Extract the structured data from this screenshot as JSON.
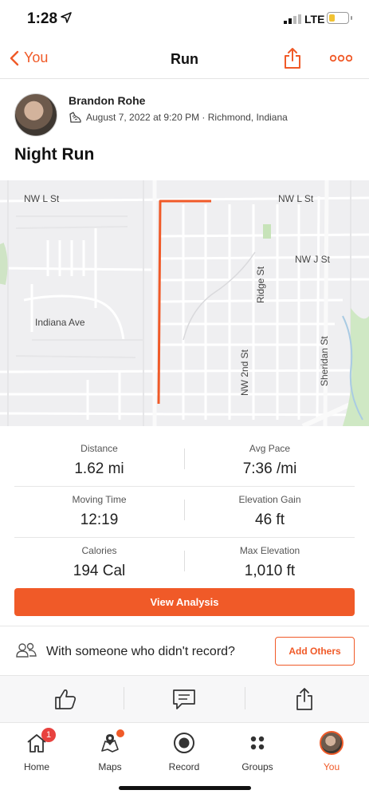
{
  "status_bar": {
    "time": "1:28",
    "network": "LTE"
  },
  "nav": {
    "back_label": "You",
    "title": "Run",
    "share_icon": "share-icon",
    "more_icon": "more-icon"
  },
  "activity": {
    "athlete_name": "Brandon Rohe",
    "date_location": "August 7, 2022 at 9:20 PM · Richmond, Indiana",
    "title": "Night Run"
  },
  "map": {
    "labels": {
      "nw_l_st_left": "NW L St",
      "nw_l_st_right": "NW L St",
      "nw_j_st": "NW J St",
      "indiana_ave": "Indiana Ave",
      "ridge_st": "Ridge St",
      "nw_2nd_st": "NW 2nd St",
      "sheridan_st": "Sheridan St"
    },
    "route_color": "#f05a28"
  },
  "stats": [
    {
      "left": {
        "label": "Distance",
        "value": "1.62 mi"
      },
      "right": {
        "label": "Avg Pace",
        "value": "7:36 /mi"
      }
    },
    {
      "left": {
        "label": "Moving Time",
        "value": "12:19"
      },
      "right": {
        "label": "Elevation Gain",
        "value": "46 ft"
      }
    },
    {
      "left": {
        "label": "Calories",
        "value": "194 Cal"
      },
      "right": {
        "label": "Max Elevation",
        "value": "1,010 ft"
      }
    }
  ],
  "view_analysis_label": "View Analysis",
  "others": {
    "prompt": "With someone who didn't record?",
    "button_label": "Add Others"
  },
  "actions": {
    "kudos_icon": "thumbs-up-icon",
    "comment_icon": "comment-icon",
    "share_icon": "share-icon"
  },
  "tabs": [
    {
      "label": "Home",
      "icon": "home-icon",
      "badge": "1"
    },
    {
      "label": "Maps",
      "icon": "maps-icon"
    },
    {
      "label": "Record",
      "icon": "record-icon"
    },
    {
      "label": "Groups",
      "icon": "groups-icon"
    },
    {
      "label": "You",
      "icon": "avatar",
      "active": true
    }
  ],
  "colors": {
    "accent": "#f05a28",
    "badge": "#e8423f"
  }
}
